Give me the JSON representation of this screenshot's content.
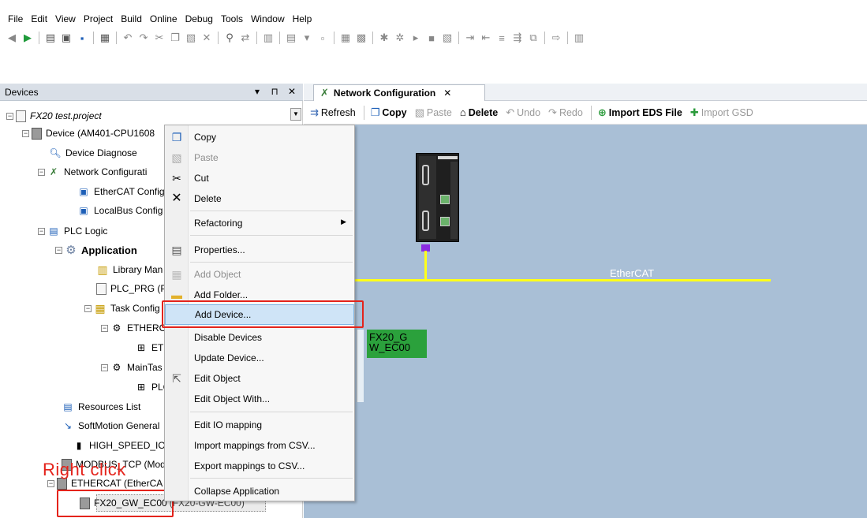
{
  "menu": [
    "File",
    "Edit",
    "View",
    "Project",
    "Build",
    "Online",
    "Debug",
    "Tools",
    "Window",
    "Help"
  ],
  "toolbar_icons": [
    "back-icon",
    "forward-icon",
    "new-icon",
    "open-icon",
    "save-icon",
    "print-icon",
    "undo-icon",
    "redo-icon",
    "cut-icon",
    "copy-icon",
    "paste-icon",
    "delete-icon",
    "find-icon",
    "replace-icon",
    "device-icon",
    "object-icon",
    "insert-icon",
    "grid-icon",
    "chart-icon",
    "build-icon",
    "clean-icon",
    "run-icon",
    "stop-icon",
    "clear-icon",
    "bookmark-icon",
    "indent-icon",
    "outdent-icon",
    "comment-icon",
    "step-icon",
    "more-icon",
    "settings-icon"
  ],
  "devices_pane": {
    "title": "Devices",
    "controls": [
      "▾",
      "⊓",
      "✕"
    ],
    "tree": [
      {
        "label": "FX20 test.project",
        "icon": "project-icon"
      },
      {
        "label": "Device (AM401-CPU1608",
        "icon": "device-icon"
      },
      {
        "label": "Device Diagnose",
        "icon": "diagnose-icon"
      },
      {
        "label": "Network Configurati",
        "icon": "network-config-icon"
      },
      {
        "label": "EtherCAT Config",
        "icon": "ethercat-config-icon"
      },
      {
        "label": "LocalBus Config",
        "icon": "localbus-config-icon"
      },
      {
        "label": "PLC Logic",
        "icon": "plc-logic-icon"
      },
      {
        "label": "Application",
        "icon": "application-icon"
      },
      {
        "label": "Library Man",
        "icon": "library-icon"
      },
      {
        "label": "PLC_PRG (P",
        "icon": "program-icon"
      },
      {
        "label": "Task Config",
        "icon": "task-config-icon"
      },
      {
        "label": "ETHERC",
        "icon": "task-icon"
      },
      {
        "label": "ETH",
        "icon": "program-ref-icon"
      },
      {
        "label": "MainTas",
        "icon": "task-icon"
      },
      {
        "label": "PLC",
        "icon": "program-ref-icon"
      },
      {
        "label": "Resources List",
        "icon": "resources-icon"
      },
      {
        "label": "SoftMotion General ",
        "icon": "softmotion-icon"
      },
      {
        "label": "HIGH_SPEED_IO (",
        "icon": "io-icon"
      },
      {
        "label": "MODBUS_TCP (Modb",
        "icon": "modbus-icon"
      },
      {
        "label": "ETHERCAT (EtherCA",
        "icon": "ethercat-icon"
      },
      {
        "label": "FX20_GW_EC00",
        "icon": "device-icon"
      }
    ],
    "selected_suffix": "(FX20-GW-EC00)",
    "annotation": "Right click"
  },
  "context_menu": {
    "items": [
      {
        "label": "Copy",
        "icon": "copy-icon",
        "disabled": false
      },
      {
        "label": "Paste",
        "icon": "paste-icon",
        "disabled": true
      },
      {
        "label": "Cut",
        "icon": "cut-icon",
        "disabled": false
      },
      {
        "label": "Delete",
        "icon": "delete-icon",
        "disabled": false
      },
      {
        "label": "Refactoring",
        "icon": "",
        "disabled": false,
        "submenu": true
      },
      {
        "label": "Properties...",
        "icon": "properties-icon",
        "disabled": false
      },
      {
        "label": "Add Object",
        "icon": "add-object-icon",
        "disabled": true
      },
      {
        "label": "Add Folder...",
        "icon": "folder-icon",
        "disabled": false
      },
      {
        "label": "Add Device...",
        "icon": "",
        "disabled": false,
        "highlighted": true
      },
      {
        "label": "Disable Devices",
        "icon": "",
        "disabled": false
      },
      {
        "label": "Update Device...",
        "icon": "",
        "disabled": false
      },
      {
        "label": "Edit Object",
        "icon": "edit-object-icon",
        "disabled": false
      },
      {
        "label": "Edit Object With...",
        "icon": "",
        "disabled": false
      },
      {
        "label": "Edit IO mapping",
        "icon": "",
        "disabled": false
      },
      {
        "label": "Import mappings from CSV...",
        "icon": "",
        "disabled": false
      },
      {
        "label": "Export mappings to CSV...",
        "icon": "",
        "disabled": false
      },
      {
        "label": "Collapse Application",
        "icon": "",
        "disabled": false
      }
    ]
  },
  "editor": {
    "tab_label": "Network Configuration",
    "tab_close": "✕",
    "toolbar": [
      {
        "label": "Refresh",
        "icon": "refresh-icon",
        "disabled": false
      },
      {
        "label": "Copy",
        "icon": "copy-icon",
        "disabled": false,
        "bold": true
      },
      {
        "label": "Paste",
        "icon": "paste-icon",
        "disabled": true
      },
      {
        "label": "Delete",
        "icon": "delete-icon",
        "disabled": false,
        "bold": true
      },
      {
        "label": "Undo",
        "icon": "undo-icon",
        "disabled": true
      },
      {
        "label": "Redo",
        "icon": "redo-icon",
        "disabled": true
      },
      {
        "label": "Import EDS File",
        "icon": "import-eds-icon",
        "disabled": false,
        "bold": true
      },
      {
        "label": "Import GSD",
        "icon": "import-gsd-icon",
        "disabled": true
      }
    ],
    "canvas": {
      "bus_label": "EtherCAT",
      "node_label": "FX20_G W_EC00",
      "colors": {
        "background": "#a9bfd6",
        "bus": "#ffff19",
        "node": "#2ba13c",
        "connector": "#8a2be2"
      }
    }
  },
  "colors": {
    "annotation": "#e4231b",
    "highlight": "#cfe4f7"
  }
}
